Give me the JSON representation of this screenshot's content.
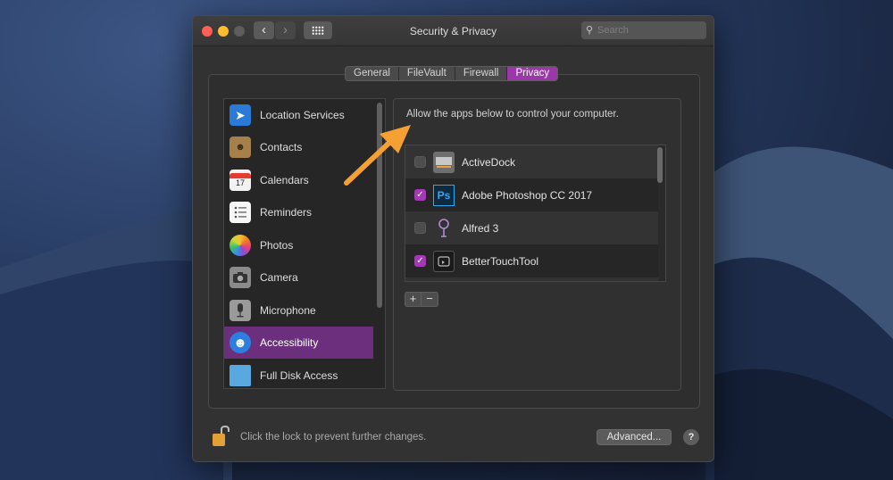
{
  "window": {
    "title": "Security & Privacy",
    "back_glyph": "‹",
    "forward_glyph": "›",
    "search_placeholder": "Search"
  },
  "tabs": [
    {
      "label": "General",
      "active": false
    },
    {
      "label": "FileVault",
      "active": false
    },
    {
      "label": "Firewall",
      "active": false
    },
    {
      "label": "Privacy",
      "active": true
    }
  ],
  "sidebar": {
    "items": [
      {
        "label": "Location Services",
        "icon": "location-arrow-icon",
        "selected": false
      },
      {
        "label": "Contacts",
        "icon": "contacts-book-icon",
        "selected": false
      },
      {
        "label": "Calendars",
        "icon": "calendar-icon",
        "selected": false,
        "icon_text": "17"
      },
      {
        "label": "Reminders",
        "icon": "reminders-list-icon",
        "selected": false
      },
      {
        "label": "Photos",
        "icon": "photos-flower-icon",
        "selected": false
      },
      {
        "label": "Camera",
        "icon": "camera-icon",
        "selected": false
      },
      {
        "label": "Microphone",
        "icon": "microphone-icon",
        "selected": false
      },
      {
        "label": "Accessibility",
        "icon": "accessibility-icon",
        "selected": true
      },
      {
        "label": "Full Disk Access",
        "icon": "folder-icon",
        "selected": false
      }
    ]
  },
  "panel": {
    "description": "Allow the apps below to control your computer.",
    "apps": [
      {
        "label": "ActiveDock",
        "checked": false,
        "icon": "activedock-icon"
      },
      {
        "label": "Adobe Photoshop CC 2017",
        "checked": true,
        "icon": "photoshop-icon",
        "icon_text": "Ps"
      },
      {
        "label": "Alfred 3",
        "checked": false,
        "icon": "alfred-icon"
      },
      {
        "label": "BetterTouchTool",
        "checked": true,
        "icon": "bettertouchtool-icon"
      }
    ],
    "add_label": "+",
    "remove_label": "−"
  },
  "footer": {
    "lock_text": "Click the lock to prevent further changes.",
    "advanced_label": "Advanced...",
    "help_label": "?"
  },
  "colors": {
    "accent": "#9b37a9",
    "selection": "#6b2f7e",
    "annotation_arrow": "#f5a033"
  }
}
